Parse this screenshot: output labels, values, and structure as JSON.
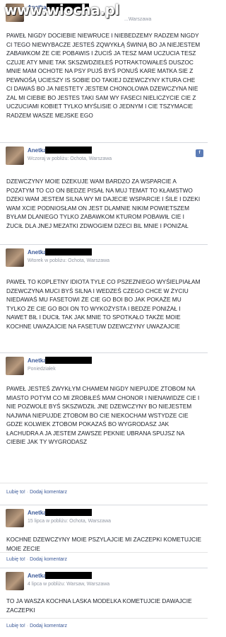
{
  "watermark": "www.wiocha.pl",
  "posts": [
    {
      "name": "Anetka",
      "meta": "...Warszawa",
      "text": "PAWEŁ NIGDY DOCIEBIE NIEWRUCE I NIEBEDZEMY RADZEM NIGDY CI TEGO NIEWYBACZE JESTEŚ ZQWYKŁĄ ŚWINIĄ BO JA NIEJESTEM ZABAWKOM ŻE CIE POBAWIS I ŻUCIŚ JA TESZ MAM UCZUCIA TESZ CZUJE ATY MNIE TAK SKSZWDZIEŁEŚ POTRAKTOWAŁEŚ DUSZOC MNIE MAM OCHOTE NA PSY PUJŚ BYŚ PONUŚ KARE MATKA SIE Z PEWNOŚĄ UCIESZY IS SOBIE DO TAKIEJ DZEWCZYNY KTURA CHE CI DAWAŚ BO JA NIESTETY JESTEM CHONOLOWA DZEWCZYNA NIE ZAL MI CIEBIE BO JESTES TAKI SAM WY FASECI NIELICZYCIE CIE Z UCZUCIAMI KOBIET TYLKO MYŚLISIE O JEDNYM I CIE TSZYMACIE RADZEM WASZE MEJSKE EGO"
    },
    {
      "name": "Anetka",
      "meta": "Wczoraj w pobliżu: Ochota, Warszawa",
      "text": "DZEWCZYNY MOIE DZEKUJE WAM BARDZO ZA WSPARCIE A POZATYM TO CO ON BEDZE PISAŁ NA MUJ TEMAT TO KŁAMSTWO DZEKI WAM JESTEM SILNA WY MI DAJECIE WSPARCIE I ŚILE I DZEKI WAM XCIE PODNIOSŁAM ON JEST DLAMNIE NIKIM POWIETSZEM BYŁAM DLANIEGO TYLKO ZABAWKOM KTUROM POBAWIŁ CIE I ŻUCIŁ DLA JNEJ MEZATKI ZDWOGIEM DZECI BIL MNIE I PONIŻAŁ"
    },
    {
      "name": "Anetka",
      "meta": "Wtorek w pobliżu: Ochota, Warszawa",
      "text": "PAWEŁ TO KOPLETNY IDIOTA TYLE CO PSZEZNIEGO WYŚIELPIAŁAM DZEWCZYNA MUCI BYŚ SILNA I WEDZEŚ CZEGO CHCE W ŻYCIU NIEDAWAŚ MU FASETOWI ŻE CIE GO BOI BO JAK POKAŻE MU TYLKO ŻE CIE GO BOI ON TO WYKOŻYSTA I BEDZE PONIŻAŁ I NAWET BIŁ I DUCIŁ TAK JAK MNIE TO SPOTKAŁO TAKŻE MOIE KOCHNE UWAZAJCIE NA FASETUW DZEWCZYNY UWAZAJCIE"
    },
    {
      "name": "Anetka",
      "meta": "Poniedziałek",
      "text": "PAWEŁ JESTEŚ ZWYKŁYM CHAMEM NIGDY NIEPUJDE ZTOBOM NA MIASTO POTYM CO MI ZROBIŁEŚ MAM CHONOR I NIENAWIDZE CIE I NIE POZWOLE BYŚ SKSZWDZIŁ JNE DZEWCZYNY BO NIEJESTEM NAJWNA NIEPUJDE ZTOBOM BO CIE NIEKOCHAM WSTYDZE CIE GDZE KOLWIEK ZTOBOM POKAZAŚ BO WYGRODASZ JAK ŁACHUDRA A JA JESTEM ZAWSZE PEKNIE UBRANA SPUJSZ NA CIEBIE JAK TY WYGRODASZ",
      "like": "Lubię to!",
      "comment": "Dodaj komentarz"
    },
    {
      "name": "Anetka",
      "meta": "15 lipca w pobliżu: Ochota, Warszawa",
      "text": "KOCHNE DZEWCZYNY MOIE PSZYLAJCIE MI ZACZEPKI KOMETUJCIE MOIE ZECIE",
      "like": "Lubię to!",
      "comment": "Dodaj komentarz"
    },
    {
      "name": "Anetka",
      "meta": "4 lipca w pobliżu: Warsaw, Warszawa",
      "text": "TO JA WASZA KOCHNA LASKA MODELKA KOMETUJCIE DAWAJCIE ZACZEPKI",
      "like": "Lubię to!",
      "comment": "Dodaj komentarz"
    }
  ],
  "icon_name": "facebook-icon",
  "accent_color": "#3b5998"
}
